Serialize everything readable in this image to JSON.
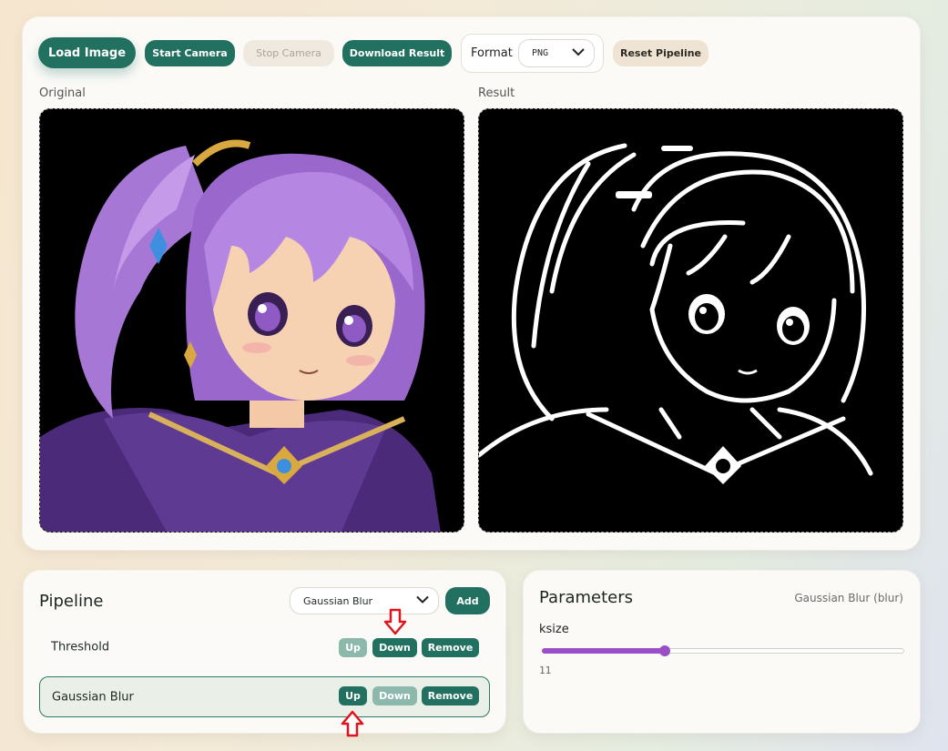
{
  "toolbar": {
    "load_image": "Load Image",
    "start_camera": "Start Camera",
    "stop_camera": "Stop Camera",
    "download_result": "Download Result",
    "format_label": "Format",
    "format_value": "PNG",
    "reset_pipeline": "Reset Pipeline"
  },
  "preview": {
    "original_label": "Original",
    "result_label": "Result"
  },
  "pipeline": {
    "title": "Pipeline",
    "add_select_value": "Gaussian Blur",
    "add_button": "Add",
    "steps": [
      {
        "name": "Threshold",
        "up": "Up",
        "down": "Down",
        "remove": "Remove",
        "up_enabled": false,
        "down_enabled": true,
        "selected": false
      },
      {
        "name": "Gaussian Blur",
        "up": "Up",
        "down": "Down",
        "remove": "Remove",
        "up_enabled": true,
        "down_enabled": false,
        "selected": true
      }
    ]
  },
  "parameters": {
    "title": "Parameters",
    "selected_step": "Gaussian Blur (blur)",
    "param_name": "ksize",
    "param_value": "11",
    "slider_fraction": 0.34
  },
  "icons": [
    "chevron-down-icon",
    "arrow-down-icon",
    "arrow-up-icon"
  ],
  "colors": {
    "accent": "#22705f",
    "accent_disabled": "#8db9ad",
    "slider": "#9b4fc6",
    "annotation_arrow": "#e0141e"
  }
}
